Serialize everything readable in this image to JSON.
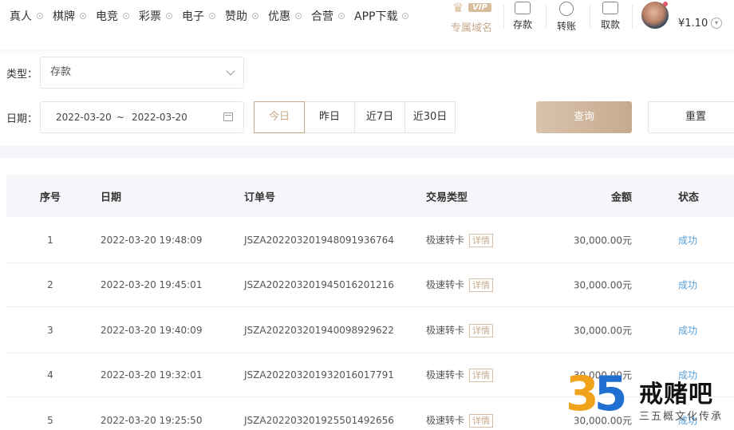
{
  "nav": {
    "items": [
      "真人",
      "棋牌",
      "电竞",
      "彩票",
      "电子",
      "赞助",
      "优惠",
      "合营",
      "APP下载"
    ]
  },
  "vip": {
    "badge": "VIP",
    "label": "专属域名"
  },
  "tools": [
    {
      "label": "存款",
      "icon": "wallet-icon"
    },
    {
      "label": "转账",
      "icon": "transfer-icon"
    },
    {
      "label": "取款",
      "icon": "card-icon"
    }
  ],
  "account": {
    "balance": "¥1.10"
  },
  "filters": {
    "type_label": "类型：",
    "type_value": "存款",
    "date_label": "日期：",
    "date_from": "2022-03-20",
    "date_sep": "~",
    "date_to": "2022-03-20",
    "quick": [
      "今日",
      "昨日",
      "近7日",
      "近30日"
    ],
    "query": "查询",
    "reset": "重置"
  },
  "table": {
    "headers": {
      "index": "序号",
      "date": "日期",
      "order": "订单号",
      "type": "交易类型",
      "amount": "金额",
      "status": "状态"
    },
    "rows": [
      {
        "index": "1",
        "date": "2022-03-20 19:48:09",
        "order": "JSZA2022032019480919367​64",
        "type": "极速转卡",
        "detail": "详情",
        "amount": "30,000.00元",
        "status": "成功"
      },
      {
        "index": "2",
        "date": "2022-03-20 19:45:01",
        "order": "JSZA20220320194501620121​6",
        "type": "极速转卡",
        "detail": "详情",
        "amount": "30,000.00元",
        "status": "成功"
      },
      {
        "index": "3",
        "date": "2022-03-20 19:40:09",
        "order": "JSZA20220320194009892962​2",
        "type": "极速转卡",
        "detail": "详情",
        "amount": "30,000.00元",
        "status": "成功"
      },
      {
        "index": "4",
        "date": "2022-03-20 19:32:01",
        "order": "JSZA20220320193201601779​1",
        "type": "极速转卡",
        "detail": "详情",
        "amount": "30,000.00元",
        "status": "成功"
      },
      {
        "index": "5",
        "date": "2022-03-20 19:25:50",
        "order": "JSZA20220320192550149265​6",
        "type": "极速转卡",
        "detail": "详情",
        "amount": "30,000.00元",
        "status": "成功"
      }
    ]
  },
  "watermark": {
    "digits": "35",
    "title": "戒赌吧",
    "subtitle": "三五概文化传承"
  },
  "colors": {
    "accent": "#c7a98a",
    "success": "#5aa0d8",
    "band": "#f3f5fa"
  }
}
